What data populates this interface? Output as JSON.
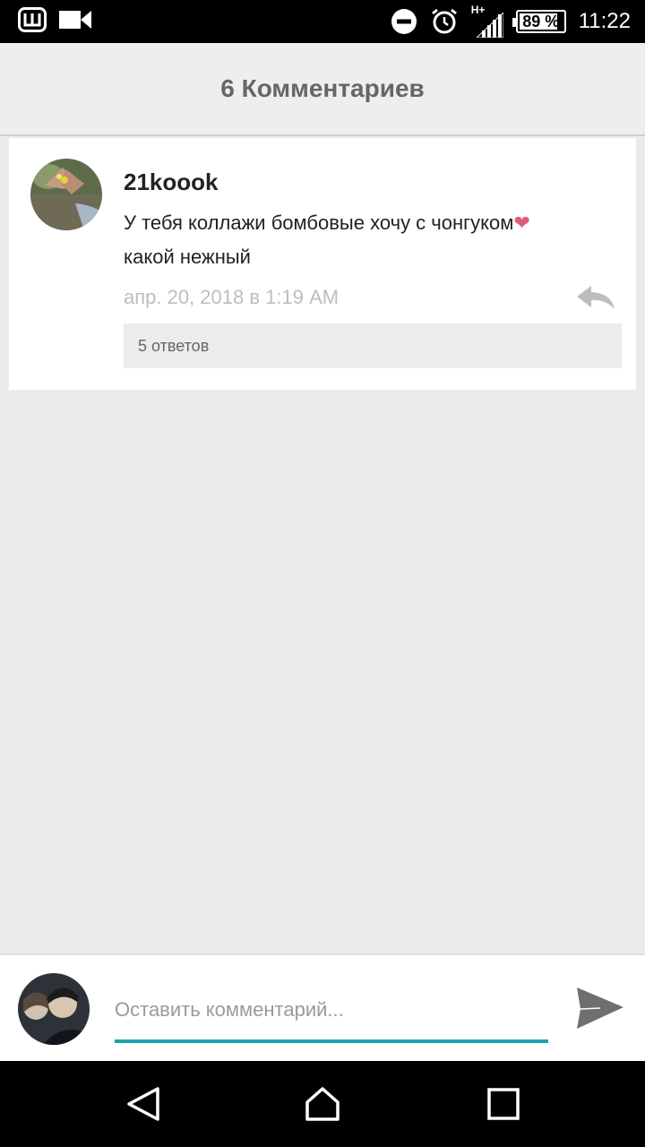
{
  "status_bar": {
    "time": "11:22",
    "battery_percent": "89 %",
    "battery_level": 0.89,
    "network": "H+",
    "left_icons": [
      "app-w-icon",
      "video-camera-icon"
    ],
    "right_icons": [
      "dnd-icon",
      "alarm-icon",
      "signal-icon",
      "battery-icon"
    ]
  },
  "header": {
    "title": "6 Комментариев"
  },
  "comment": {
    "username": "21koook",
    "text": "У тебя коллажи бомбовые хочу с чонгуком",
    "emoji": "❤",
    "text_line2": "какой нежный",
    "date": "апр. 20, 2018 в 1:19 AM",
    "replies_label": "5 ответов"
  },
  "compose": {
    "placeholder": "Оставить комментарий...",
    "value": ""
  },
  "colors": {
    "accent": "#1aa3ad",
    "heart": "#e05a7b",
    "background": "#ecebec"
  },
  "nav": {
    "buttons": [
      "back-icon",
      "home-icon",
      "recents-icon"
    ]
  }
}
